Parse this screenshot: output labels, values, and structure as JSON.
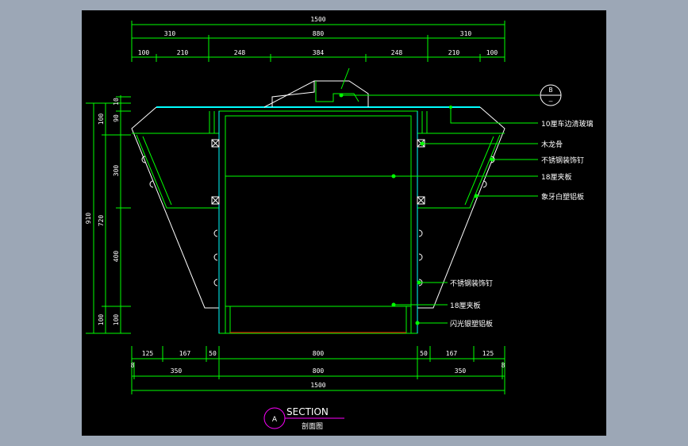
{
  "colors": {
    "background": "#9ca7b6",
    "viewport": "#000000",
    "dimension_line": "#00ff00",
    "outline": "#ffffff",
    "cabinet": "#00ff00",
    "glass": "#00ffff",
    "base_edge": "#ff0000",
    "section_symbol": "#ff00ff",
    "text": "#ffffff"
  },
  "dimensions": {
    "top_overall": "1500",
    "top_row1": [
      "310",
      "880",
      "310"
    ],
    "top_row2": [
      "100",
      "210",
      "248",
      "384",
      "248",
      "210",
      "100"
    ],
    "left_overall": "910",
    "left_row1": [
      "100",
      "720",
      "100"
    ],
    "left_row2": [
      "90",
      "10",
      "300",
      "400",
      "100"
    ],
    "left_top_tiny": [
      "10",
      "10"
    ],
    "bottom_row1": [
      "125",
      "167",
      "50",
      "800",
      "50",
      "167",
      "125"
    ],
    "bottom_row2": [
      "8",
      "350",
      "800",
      "350",
      "8"
    ],
    "bottom_overall": "1500"
  },
  "annotations": [
    "10厘车边清玻璃",
    "木龙骨",
    "不锈钢装饰钉",
    "18厘夹板",
    "象牙白塑铝板",
    "不锈钢装饰钉",
    "18厘夹板",
    "闪光银塑铝板"
  ],
  "callout": {
    "letter": "B",
    "number": "—"
  },
  "title": {
    "symbol_letter": "A",
    "section_label": "SECTION",
    "section_cn": "剖面图"
  }
}
